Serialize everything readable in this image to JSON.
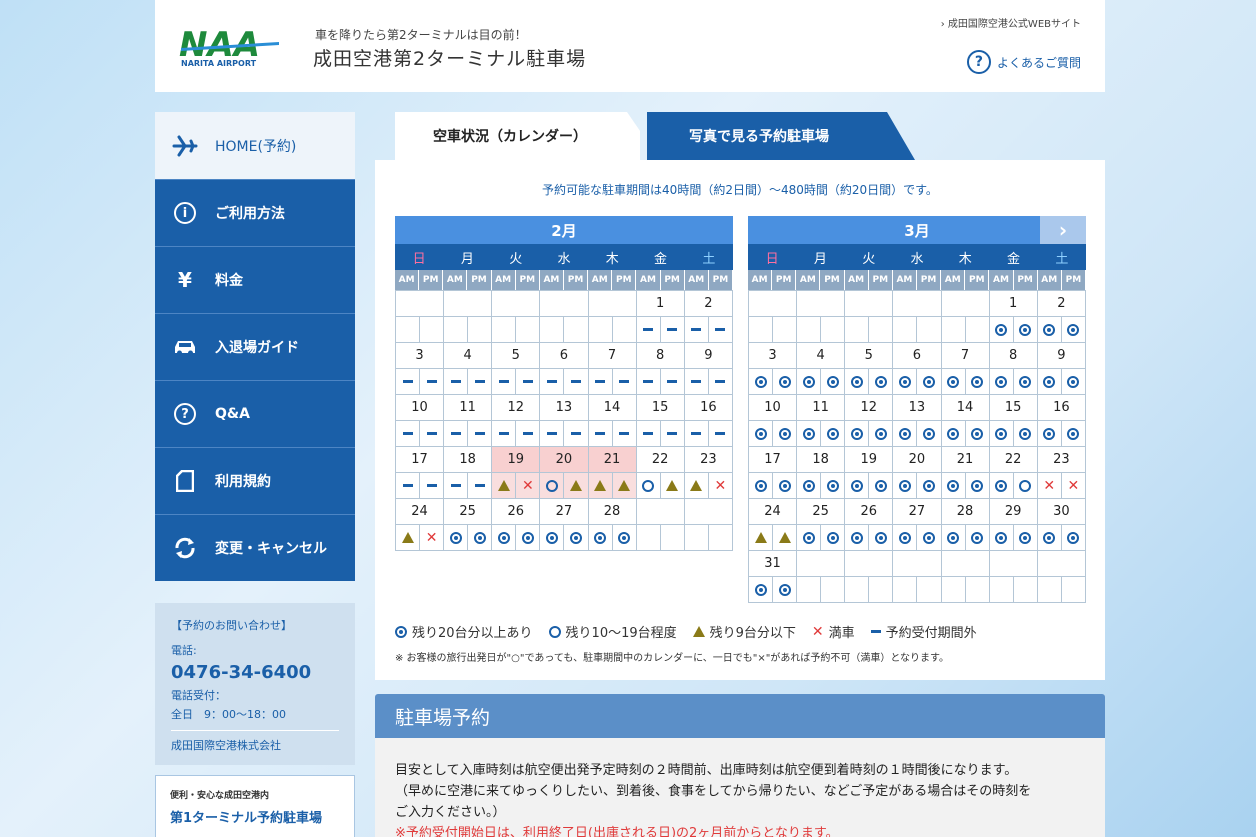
{
  "header": {
    "logo_text": "NAA",
    "logo_sub": "NARITA AIRPORT",
    "tagline": "車を降りたら第2ターミナルは目の前！",
    "title": "成田空港第2ターミナル駐車場",
    "official_link": "› 成田国際空港公式WEBサイト",
    "faq": "よくあるご質問"
  },
  "nav": [
    {
      "label": "HOME(予約)",
      "icon": "airplane-icon"
    },
    {
      "label": "ご利用方法",
      "icon": "info-icon"
    },
    {
      "label": "料金",
      "icon": "yen-icon"
    },
    {
      "label": "入退場ガイド",
      "icon": "car-icon"
    },
    {
      "label": "Q&A",
      "icon": "question-icon"
    },
    {
      "label": "利用規約",
      "icon": "document-icon"
    },
    {
      "label": "変更・キャンセル",
      "icon": "refresh-icon"
    }
  ],
  "contact": {
    "title": "【予約のお問い合わせ】",
    "tel_label": "電話:",
    "tel": "0476-34-6400",
    "hours_label": "電話受付：",
    "hours": "全日　9：00〜18：00",
    "company": "成田国際空港株式会社"
  },
  "promo": {
    "sub": "便利・安心な成田空港内",
    "title": "第1ターミナル予約駐車場"
  },
  "tabs": {
    "calendar": "空車状況（カレンダー）",
    "photo": "写真で見る予約駐車場"
  },
  "period": "予約可能な駐車期間は40時間（約2日間）〜480時間（約20日間）です。",
  "weekdays": [
    "日",
    "月",
    "火",
    "水",
    "木",
    "金",
    "土"
  ],
  "ampm": [
    "AM",
    "PM"
  ],
  "feb": {
    "month": "2月",
    "weeks": [
      {
        "days": [
          "",
          "",
          "",
          "",
          "",
          "1",
          "2"
        ],
        "pink": [],
        "st": [
          "",
          "",
          "",
          "",
          "",
          "",
          "",
          "",
          "",
          "",
          "-",
          "-",
          "-",
          "-"
        ]
      },
      {
        "days": [
          "3",
          "4",
          "5",
          "6",
          "7",
          "8",
          "9"
        ],
        "pink": [],
        "st": [
          "-",
          "-",
          "-",
          "-",
          "-",
          "-",
          "-",
          "-",
          "-",
          "-",
          "-",
          "-",
          "-",
          "-"
        ]
      },
      {
        "days": [
          "10",
          "11",
          "12",
          "13",
          "14",
          "15",
          "16"
        ],
        "pink": [],
        "st": [
          "-",
          "-",
          "-",
          "-",
          "-",
          "-",
          "-",
          "-",
          "-",
          "-",
          "-",
          "-",
          "-",
          "-"
        ]
      },
      {
        "days": [
          "17",
          "18",
          "19",
          "20",
          "21",
          "22",
          "23"
        ],
        "pink": [
          2,
          3,
          4
        ],
        "st": [
          "-",
          "-",
          "-",
          "-",
          "t",
          "x",
          "o",
          "t",
          "t",
          "t",
          "o",
          "t",
          "t",
          "x"
        ]
      },
      {
        "days": [
          "24",
          "25",
          "26",
          "27",
          "28",
          "",
          ""
        ],
        "pink": [],
        "st": [
          "t",
          "x",
          "d",
          "d",
          "d",
          "d",
          "d",
          "d",
          "d",
          "d",
          "",
          "",
          "",
          ""
        ]
      }
    ]
  },
  "mar": {
    "month": "3月",
    "next": "›",
    "weeks": [
      {
        "days": [
          "",
          "",
          "",
          "",
          "",
          "1",
          "2"
        ],
        "pink": [],
        "st": [
          "",
          "",
          "",
          "",
          "",
          "",
          "",
          "",
          "",
          "",
          "d",
          "d",
          "d",
          "d"
        ]
      },
      {
        "days": [
          "3",
          "4",
          "5",
          "6",
          "7",
          "8",
          "9"
        ],
        "pink": [],
        "st": [
          "d",
          "d",
          "d",
          "d",
          "d",
          "d",
          "d",
          "d",
          "d",
          "d",
          "d",
          "d",
          "d",
          "d"
        ]
      },
      {
        "days": [
          "10",
          "11",
          "12",
          "13",
          "14",
          "15",
          "16"
        ],
        "pink": [],
        "st": [
          "d",
          "d",
          "d",
          "d",
          "d",
          "d",
          "d",
          "d",
          "d",
          "d",
          "d",
          "d",
          "d",
          "d"
        ]
      },
      {
        "days": [
          "17",
          "18",
          "19",
          "20",
          "21",
          "22",
          "23"
        ],
        "pink": [],
        "st": [
          "d",
          "d",
          "d",
          "d",
          "d",
          "d",
          "d",
          "d",
          "d",
          "d",
          "d",
          "o",
          "x",
          "x"
        ]
      },
      {
        "days": [
          "24",
          "25",
          "26",
          "27",
          "28",
          "29",
          "30"
        ],
        "pink": [],
        "st": [
          "t",
          "t",
          "d",
          "d",
          "d",
          "d",
          "d",
          "d",
          "d",
          "d",
          "d",
          "d",
          "d",
          "d"
        ]
      },
      {
        "days": [
          "31",
          "",
          "",
          "",
          "",
          "",
          ""
        ],
        "pink": [],
        "st": [
          "d",
          "d",
          "",
          "",
          "",
          "",
          "",
          "",
          "",
          "",
          "",
          "",
          "",
          ""
        ]
      }
    ]
  },
  "legend": {
    "d": "残り20台分以上あり",
    "o": "残り10〜19台程度",
    "t": "残り9台分以下",
    "x": "満車",
    "dash": "予約受付期間外"
  },
  "note": "※ お客様の旅行出発日が\"○\"であっても、駐車期間中のカレンダーに、一日でも\"×\"があれば予約不可（満車）となります。",
  "reservation": {
    "title": "駐車場予約",
    "line1": "目安として入庫時刻は航空便出発予定時刻の２時間前、出庫時刻は航空便到着時刻の１時間後になります。",
    "line2": "（早めに空港に来てゆっくりしたい、到着後、食事をしてから帰りたい、などご予定がある場合はその時刻を",
    "line3": "ご入力ください。）",
    "warning": "※予約受付開始日は、利用終了日(出庫される日)の2ヶ月前からとなります。"
  }
}
